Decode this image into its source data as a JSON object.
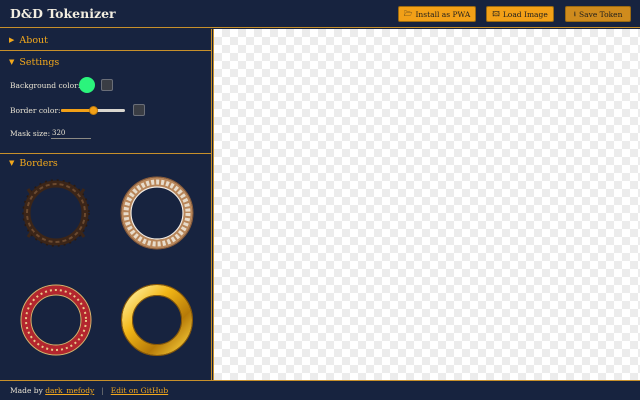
{
  "header": {
    "title": "D&D Tokenizer",
    "buttons": {
      "install": {
        "icon": "folder-icon",
        "label": "Install as PWA"
      },
      "load": {
        "icon": "image-icon",
        "label": "Load Image"
      },
      "save": {
        "icon": "download-icon",
        "label": "Save Token"
      }
    }
  },
  "sidebar": {
    "sections": {
      "about": {
        "label": "About",
        "expanded": false
      },
      "settings": {
        "label": "Settings",
        "expanded": true
      },
      "borders": {
        "label": "Borders",
        "expanded": true
      }
    },
    "settings": {
      "background_color_label": "Background color:",
      "background_color": "#2bf47c",
      "border_color_label": "Border color:",
      "border_color_slider": 0.5,
      "mask_size_label": "Mask size:",
      "mask_size_value": "320"
    },
    "borders": [
      {
        "name": "dark-dragon-ring"
      },
      {
        "name": "silver-ornate-ring"
      },
      {
        "name": "red-gold-patterned-ring"
      },
      {
        "name": "gold-ring"
      }
    ]
  },
  "footer": {
    "made_by": "Made by",
    "author": "dark_mefody",
    "separator": "|",
    "github": "Edit on GitHub"
  },
  "colors": {
    "background": "#17233f",
    "accent": "#f2a017",
    "accent_border": "#c7902b"
  }
}
